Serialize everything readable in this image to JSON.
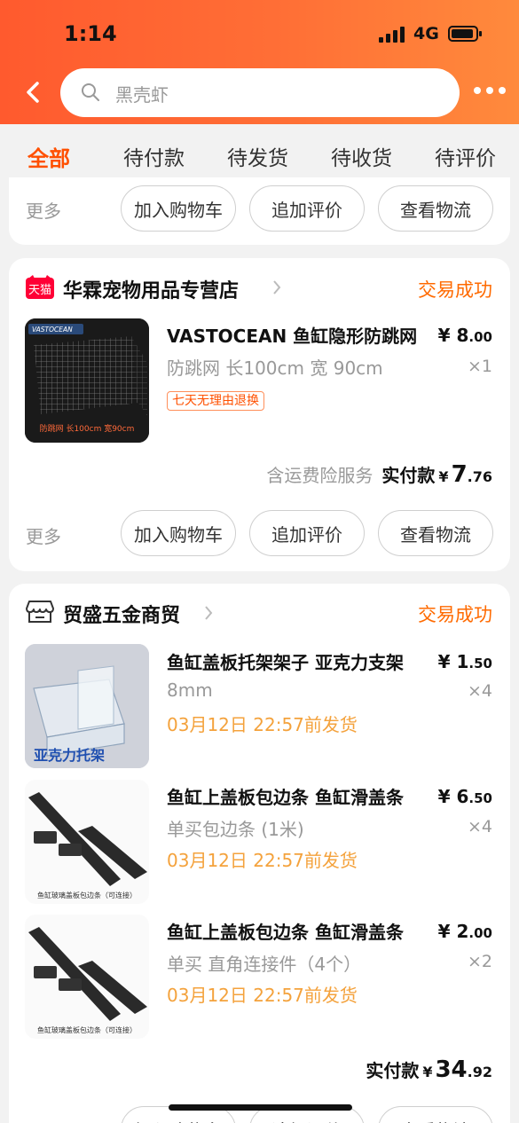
{
  "status_bar": {
    "time": "1:14",
    "network": "4G"
  },
  "header": {
    "search_placeholder": "黑壳虾"
  },
  "tabs": [
    "全部",
    "待付款",
    "待发货",
    "待收货",
    "待评价"
  ],
  "actions": {
    "more": "更多",
    "add_cart": "加入购物车",
    "add_review": "追加评价",
    "view_logistics": "查看物流"
  },
  "orders": [
    {
      "shop": "华霖宠物用品专营店",
      "badge": "天猫",
      "status": "交易成功",
      "items": [
        {
          "title": "VASTOCEAN 鱼缸隐形防跳网",
          "spec": "防跳网 长100cm 宽 90cm",
          "tag": "七天无理由退换",
          "price_int": "8",
          "price_dec": ".00",
          "qty": "×1",
          "thumb_brand": "VASTOCEAN",
          "thumb_caption": "防跳网 长100cm 宽90cm"
        }
      ],
      "pay_note": "含运费险服务",
      "pay_label": "实付款",
      "pay_int": "7",
      "pay_dec": ".76"
    },
    {
      "shop": "贸盛五金商贸",
      "status": "交易成功",
      "items": [
        {
          "title": "鱼缸盖板托架架子 亚克力支架",
          "spec": "8mm",
          "ship": "03月12日 22:57前发货",
          "price_int": "1",
          "price_dec": ".50",
          "qty": "×4",
          "thumb_caption": "亚克力托架"
        },
        {
          "title": "鱼缸上盖板包边条 鱼缸滑盖条",
          "spec": "单买包边条 (1米)",
          "ship": "03月12日 22:57前发货",
          "price_int": "6",
          "price_dec": ".50",
          "qty": "×4",
          "thumb_caption": "鱼缸玻璃盖板包边条（可连接）"
        },
        {
          "title": "鱼缸上盖板包边条 鱼缸滑盖条",
          "spec": "单买 直角连接件（4个）",
          "ship": "03月12日 22:57前发货",
          "price_int": "2",
          "price_dec": ".00",
          "qty": "×2",
          "thumb_caption": "鱼缸玻璃盖板包边条（可连接）"
        }
      ],
      "pay_label": "实付款",
      "pay_int": "34",
      "pay_dec": ".92"
    }
  ],
  "currency": "¥",
  "colors": {
    "accent": "#ff5000",
    "status_orange": "#ff6a00",
    "ship_orange": "#f4a23c"
  }
}
